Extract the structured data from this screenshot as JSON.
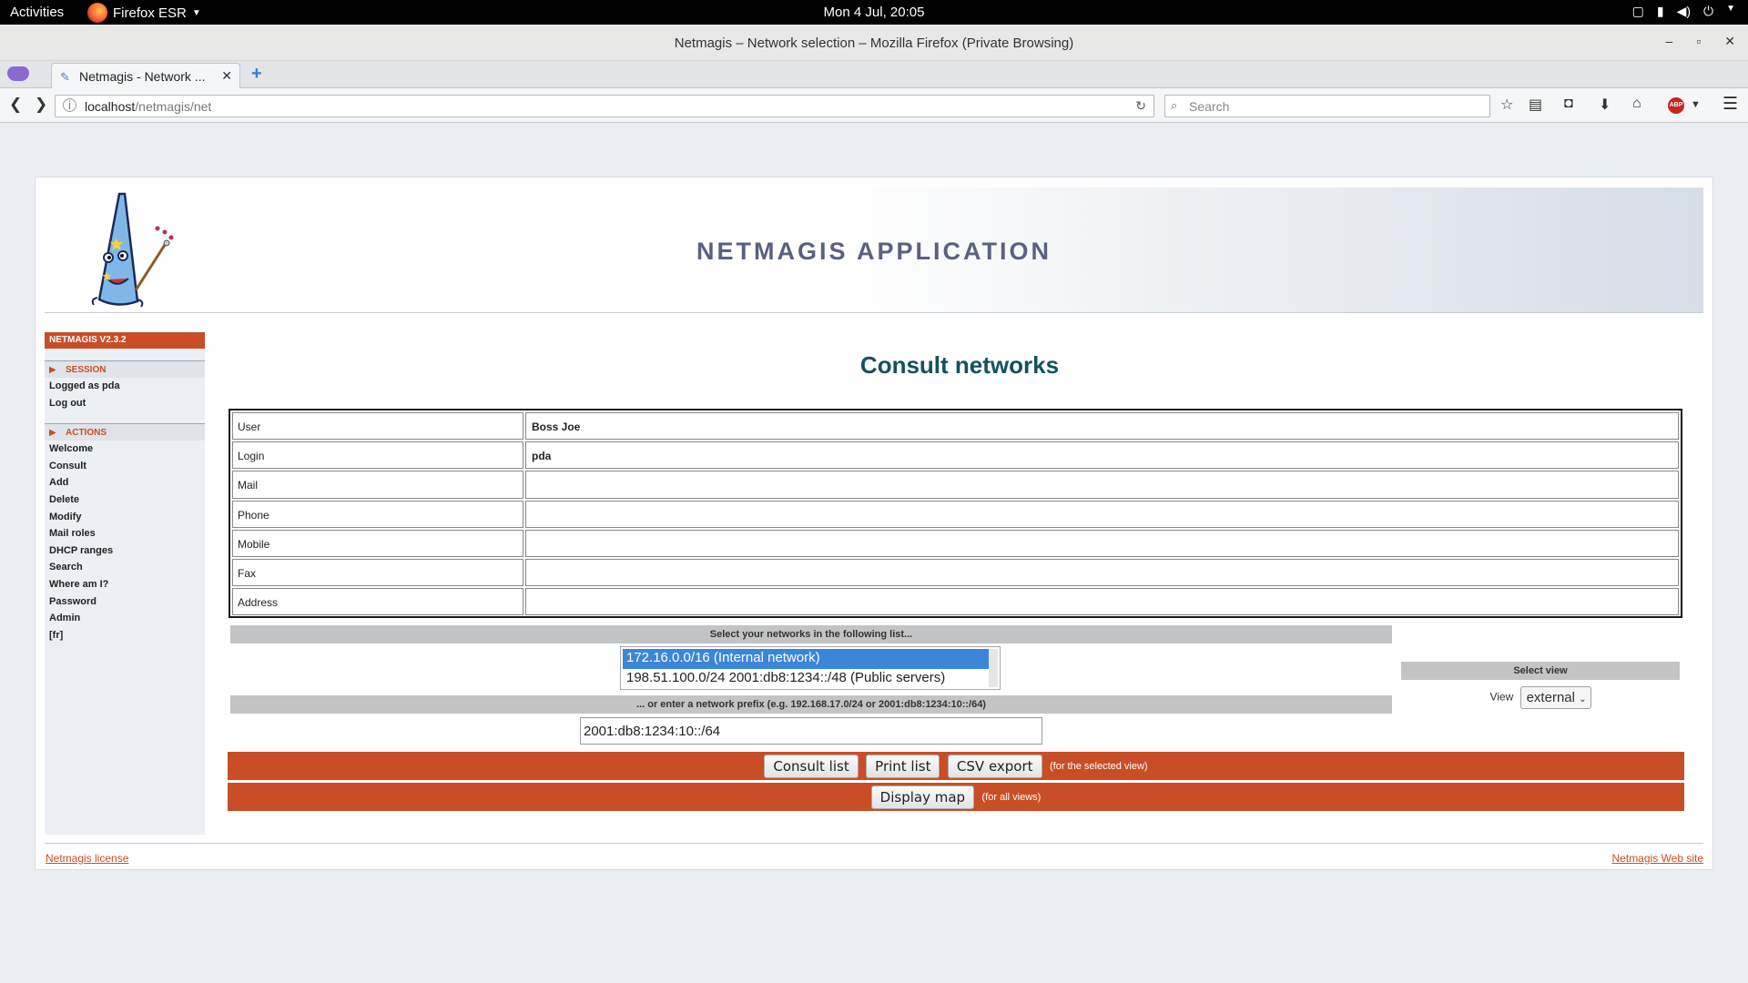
{
  "desktop": {
    "activities": "Activities",
    "app_menu": "Firefox ESR",
    "clock": "Mon  4 Jul, 20:05"
  },
  "window": {
    "title": "Netmagis – Network selection – Mozilla Firefox (Private Browsing)"
  },
  "browser": {
    "tab_title": "Netmagis - Network ...",
    "url_host": "localhost",
    "url_path": "/netmagis/net",
    "search_placeholder": "Search",
    "abp_badge": "ABP"
  },
  "header": {
    "app_title": "NETMAGIS APPLICATION"
  },
  "sidebar": {
    "version": "NETMAGIS V2.3.2",
    "session_title": "SESSION",
    "session_items": [
      "Logged as pda",
      "Log out"
    ],
    "actions_title": "ACTIONS",
    "action_items": [
      "Welcome",
      "Consult",
      "Add",
      "Delete",
      "Modify",
      "Mail roles",
      "DHCP ranges",
      "Search",
      "Where am I?",
      "Password",
      "Admin",
      "[fr]"
    ]
  },
  "main": {
    "title": "Consult networks",
    "user_info": [
      {
        "label": "User",
        "value": "Boss Joe"
      },
      {
        "label": "Login",
        "value": "pda"
      },
      {
        "label": "Mail",
        "value": ""
      },
      {
        "label": "Phone",
        "value": ""
      },
      {
        "label": "Mobile",
        "value": ""
      },
      {
        "label": "Fax",
        "value": ""
      },
      {
        "label": "Address",
        "value": ""
      }
    ],
    "select_networks_label": "Select your networks in the following list...",
    "networks": [
      {
        "label": "172.16.0.0/16 (Internal network)",
        "selected": true
      },
      {
        "label": "198.51.100.0/24 2001:db8:1234::/48 (Public servers)",
        "selected": false
      }
    ],
    "prefix_label": "... or enter a network prefix (e.g. 192.168.17.0/24 or 2001:db8:1234:10::/64)",
    "prefix_value": "2001:db8:1234:10::/64",
    "view": {
      "title": "Select view",
      "label": "View",
      "selected": "external"
    },
    "actions": {
      "consult_list": "Consult list",
      "print_list": "Print list",
      "csv_export": "CSV export",
      "selected_view_note": "(for the selected view)",
      "display_map": "Display map",
      "all_views_note": "(for all views)"
    }
  },
  "footer": {
    "license_link": "Netmagis license",
    "website_link": "Netmagis Web site"
  },
  "colors": {
    "accent": "#c94e25",
    "title": "#16505e",
    "selection": "#3b86d8"
  }
}
